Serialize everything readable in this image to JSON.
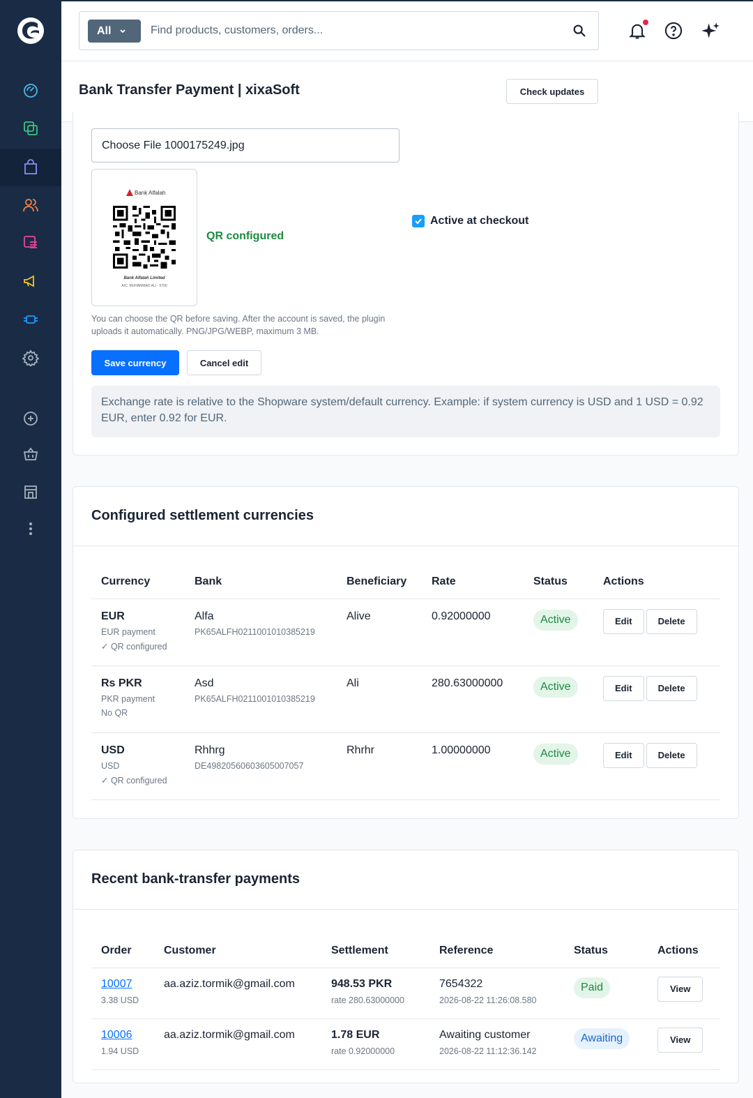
{
  "colors": {
    "sidebar": "#1a2c45",
    "primary": "#0870ff",
    "success": "#1c8a40",
    "notification": "#de294c"
  },
  "search": {
    "filter_label": "All",
    "placeholder": "Find products, customers, orders..."
  },
  "header": {
    "icons": [
      "bell-icon",
      "help-icon",
      "sparkle-icon"
    ]
  },
  "sidebar": {
    "items": [
      "dashboard-icon",
      "catalogue-icon",
      "orders-icon",
      "customers-icon",
      "content-icon",
      "marketing-icon",
      "extensions-icon",
      "settings-icon",
      "add-sales-channel-icon",
      "basket-icon",
      "storefront-icon",
      "more-icon"
    ]
  },
  "page": {
    "title": "Bank Transfer Payment | xixaSoft",
    "check_updates": "Check updates"
  },
  "form": {
    "file_input": "Choose File 1000175249.jpg",
    "qr_bank_name": "Bank Alfalah",
    "qr_footer_1": "Bank Alfalah Limited",
    "qr_footer_2": "A/C: MUHAMMAD ALI - 5700",
    "qr_status": "QR configured",
    "active_label": "Active at checkout",
    "hint": "You can choose the QR before saving. After the account is saved, the plugin uploads it automatically. PNG/JPG/WEBP, maximum 3 MB.",
    "save_label": "Save currency",
    "cancel_label": "Cancel edit",
    "info": "Exchange rate is relative to the Shopware system/default currency. Example: if system currency is USD and 1 USD = 0.92 EUR, enter 0.92 for EUR."
  },
  "currencies": {
    "title": "Configured settlement currencies",
    "headers": [
      "Currency",
      "Bank",
      "Beneficiary",
      "Rate",
      "Status",
      "Actions"
    ],
    "edit_label": "Edit",
    "delete_label": "Delete",
    "rows": [
      {
        "code": "EUR",
        "label": "EUR payment",
        "qr": "✓ QR configured",
        "bank": "Alfa",
        "iban": "PK65ALFH0211001010385219",
        "beneficiary": "Alive",
        "rate": "0.92000000",
        "status": "Active"
      },
      {
        "code": "Rs PKR",
        "label": "PKR payment",
        "qr": "No QR",
        "bank": "Asd",
        "iban": "PK65ALFH0211001010385219",
        "beneficiary": "Ali",
        "rate": "280.63000000",
        "status": "Active"
      },
      {
        "code": "USD",
        "label": "USD",
        "qr": "✓ QR configured",
        "bank": "Rhhrg",
        "iban": "DE49820560603605007057",
        "beneficiary": "Rhrhr",
        "rate": "1.00000000",
        "status": "Active"
      }
    ]
  },
  "payments": {
    "title": "Recent bank-transfer payments",
    "headers": [
      "Order",
      "Customer",
      "Settlement",
      "Reference",
      "Status",
      "Actions"
    ],
    "view_label": "View",
    "rows": [
      {
        "order": "10007",
        "order_total": "3.38 USD",
        "customer": "aa.aziz.tormik@gmail.com",
        "settlement": "948.53 PKR",
        "rate": "rate 280.63000000",
        "reference": "7654322",
        "timestamp": "2026-08-22 11:26:08.580",
        "status": "Paid"
      },
      {
        "order": "10006",
        "order_total": "1.94 USD",
        "customer": "aa.aziz.tormik@gmail.com",
        "settlement": "1.78 EUR",
        "rate": "rate 0.92000000",
        "reference": "Awaiting customer",
        "timestamp": "2026-08-22 11:12:36.142",
        "status": "Awaiting"
      }
    ]
  }
}
